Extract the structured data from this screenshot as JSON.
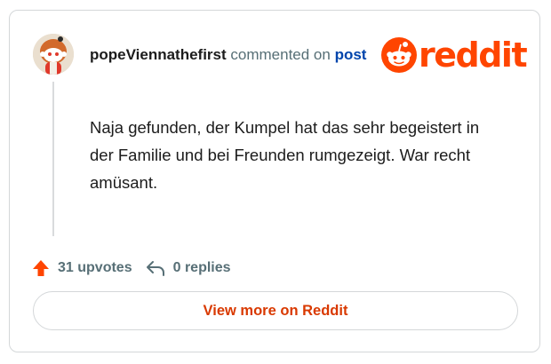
{
  "comment": {
    "username": "popeViennathefirst",
    "action_text": "commented on",
    "post_link": "post",
    "body": "Naja gefunden, der Kumpel hat das sehr begeistert in der Familie und bei Freunden rumgezeigt. War recht amüsant.",
    "upvotes": "31 upvotes",
    "replies": "0 replies"
  },
  "brand": {
    "logo_text": "reddit",
    "logo_icon": "reddit-snoo-icon",
    "color": "#ff4500"
  },
  "actions": {
    "view_more_label": "View more on Reddit"
  },
  "icons": {
    "upvote": "upvote-arrow-icon",
    "reply": "reply-arrow-icon"
  },
  "colors": {
    "accent": "#ff4500",
    "button_text": "#d93900",
    "link": "#0045ac",
    "meta_text": "#576f76",
    "body_text": "#1c1c1c",
    "border": "#d4d7d9"
  }
}
